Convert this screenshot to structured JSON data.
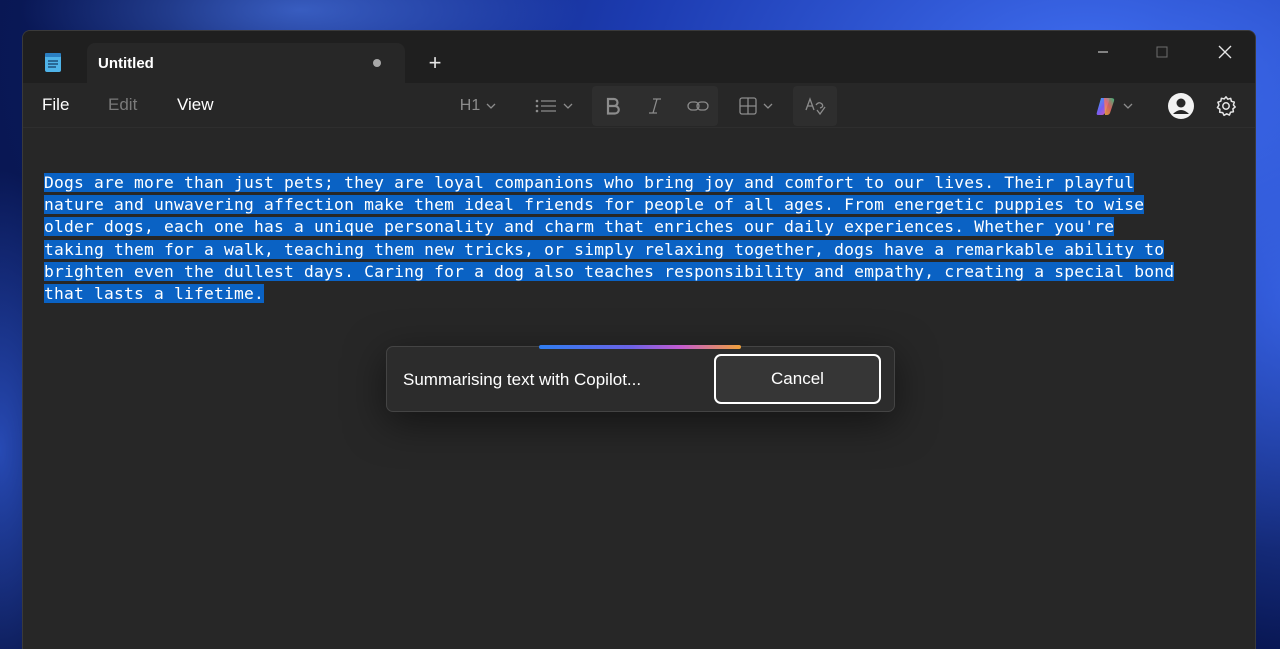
{
  "window": {
    "tab_title": "Untitled",
    "new_tab_label": "+"
  },
  "menu": {
    "file": "File",
    "edit": "Edit",
    "view": "View"
  },
  "toolbar": {
    "heading_label": "H1",
    "icons": [
      "list-icon",
      "bold-icon",
      "italic-icon",
      "link-icon",
      "table-icon",
      "spellcheck-icon",
      "copilot-icon",
      "account-icon",
      "gear-icon"
    ]
  },
  "document": {
    "lines": [
      "Dogs are more than just pets; they are loyal companions who bring joy and comfort to our lives. Their playful ",
      "nature and unwavering affection make them ideal friends for people of all ages. From energetic puppies to wise ",
      "older dogs, each one has a unique personality and charm that enriches our daily experiences. Whether you're ",
      "taking them for a walk, teaching them new tricks, or simply relaxing together, dogs have a remarkable ability to ",
      "brighten even the dullest days. Caring for a dog also teaches responsibility and empathy, creating a special bond ",
      "that lasts a lifetime."
    ]
  },
  "toast": {
    "message": "Summarising text with Copilot...",
    "cancel_label": "Cancel"
  },
  "colors": {
    "selection": "#0a62c4",
    "background": "#272727",
    "titlebar": "#1f1f1f"
  }
}
